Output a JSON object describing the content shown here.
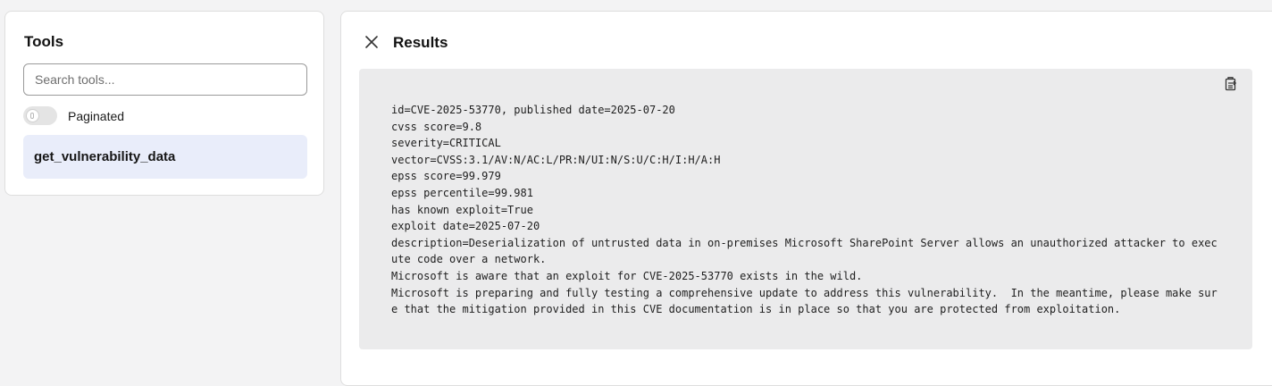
{
  "tools": {
    "title": "Tools",
    "search_placeholder": "Search tools...",
    "paginated_label": "Paginated",
    "paginated_on": false,
    "items": [
      {
        "label": "get_vulnerability_data"
      }
    ]
  },
  "results": {
    "title": "Results",
    "close_icon": "close-icon",
    "copy_icon": "copy-icon",
    "text": "id=CVE-2025-53770, published date=2025-07-20\ncvss score=9.8\nseverity=CRITICAL\nvector=CVSS:3.1/AV:N/AC:L/PR:N/UI:N/S:U/C:H/I:H/A:H\nepss score=99.979\nepss percentile=99.981\nhas known exploit=True\nexploit date=2025-07-20\ndescription=Deserialization of untrusted data in on-premises Microsoft SharePoint Server allows an unauthorized attacker to execute code over a network.\nMicrosoft is aware that an exploit for CVE-2025-53770 exists in the wild.\nMicrosoft is preparing and fully testing a comprehensive update to address this vulnerability.  In the meantime, please make sure that the mitigation provided in this CVE documentation is in place so that you are protected from exploitation."
  },
  "colors": {
    "page_bg": "#f3f3f4",
    "tool_item_bg": "#e9edfa",
    "code_bg": "#ebebec"
  }
}
